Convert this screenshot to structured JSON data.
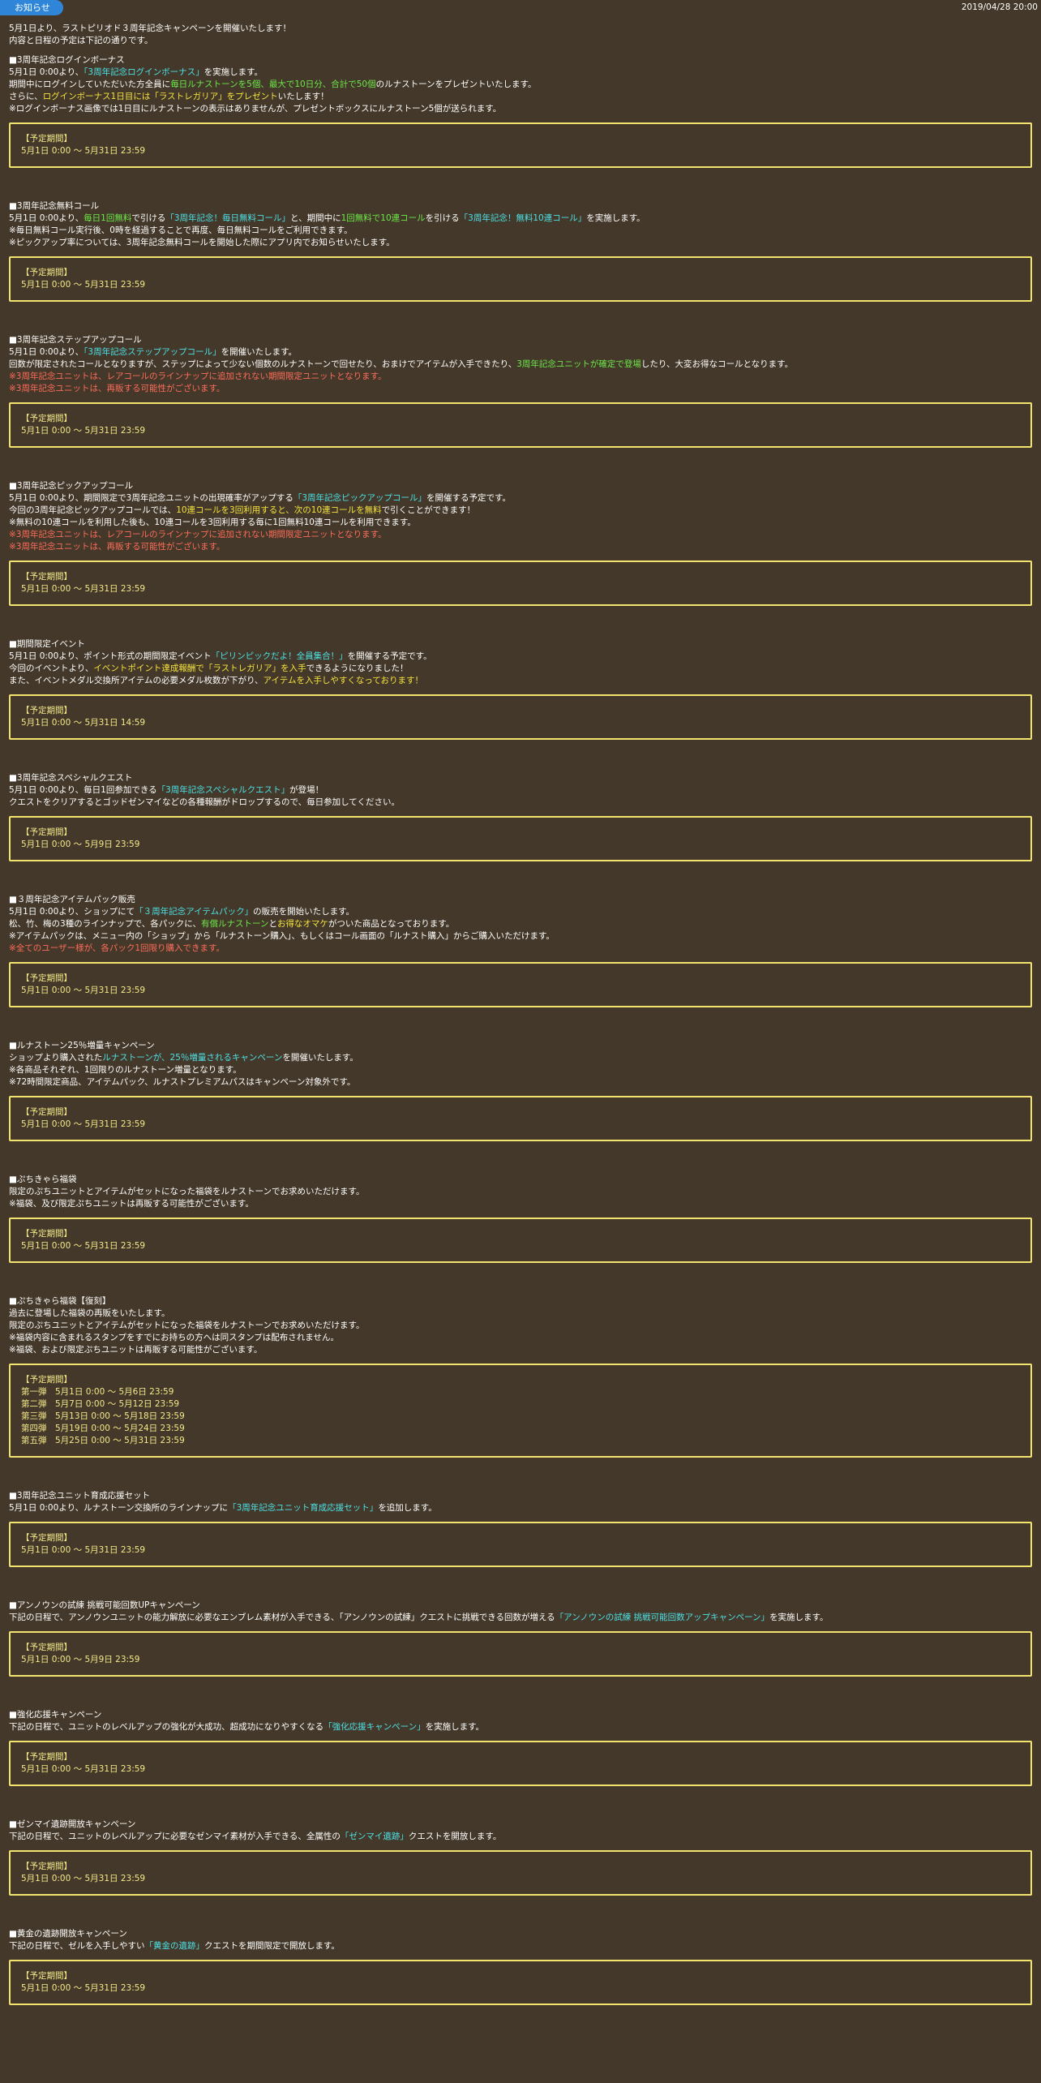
{
  "header": {
    "tab_label": "お知らせ",
    "date": "2019/04/28 20:00"
  },
  "intro": [
    "5月1日より、ラストピリオド３周年記念キャンペーンを開催いたします！",
    "内容と日程の予定は下記の通りです。"
  ],
  "period_label": "【予定期間】",
  "colors": {
    "background": "#433829",
    "box_border": "#f3e46f",
    "cyan": "#4de0e6",
    "green": "#6ee84a",
    "yellow": "#f6e33e",
    "red": "#ff6d5a",
    "tab_blue": "#2f86d8"
  },
  "sections": [
    {
      "title": "■3周年記念ログインボーナス",
      "lines": [
        [
          {
            "t": "5月1日 0:00より、"
          },
          {
            "t": "「3周年記念ログインボーナス」",
            "c": "c"
          },
          {
            "t": "を実施します。"
          }
        ],
        [
          {
            "t": "期間中にログインしていただいた方全員に"
          },
          {
            "t": "毎日ルナストーンを5個、最大で10日分、合計で50個",
            "c": "g"
          },
          {
            "t": "のルナストーンをプレゼントいたします。"
          }
        ],
        [
          {
            "t": "さらに、"
          },
          {
            "t": "ログインボーナス1日目には「ラストレガリア」をプレゼント",
            "c": "y"
          },
          {
            "t": "いたします！"
          }
        ],
        [
          {
            "t": "※ログインボーナス画像では1日目にルナストーンの表示はありませんが、プレゼントボックスにルナストーン5個が送られます。"
          }
        ]
      ],
      "periods": [
        "5月1日 0:00 ～ 5月31日 23:59"
      ]
    },
    {
      "title": "■3周年記念無料コール",
      "lines": [
        [
          {
            "t": "5月1日 0:00より、"
          },
          {
            "t": "毎日1回無料",
            "c": "g"
          },
          {
            "t": "で引ける"
          },
          {
            "t": "「3周年記念！毎日無料コール」",
            "c": "c"
          },
          {
            "t": "と、期間中に"
          },
          {
            "t": "1回無料で10連コール",
            "c": "g"
          },
          {
            "t": "を引ける"
          },
          {
            "t": "「3周年記念！無料10連コール」",
            "c": "c"
          },
          {
            "t": "を実施します。"
          }
        ],
        [
          {
            "t": "※毎日無料コール実行後、0時を経過することで再度、毎日無料コールをご利用できます。"
          }
        ],
        [
          {
            "t": "※ピックアップ率については、3周年記念無料コールを開始した際にアプリ内でお知らせいたします。"
          }
        ]
      ],
      "periods": [
        "5月1日 0:00 ～ 5月31日 23:59"
      ]
    },
    {
      "title": "■3周年記念ステップアップコール",
      "lines": [
        [
          {
            "t": "5月1日 0:00より、"
          },
          {
            "t": "「3周年記念ステップアップコール」",
            "c": "c"
          },
          {
            "t": "を開催いたします。"
          }
        ],
        [
          {
            "t": "回数が限定されたコールとなりますが、ステップによって少ない個数のルナストーンで回せたり、おまけでアイテムが入手できたり、"
          },
          {
            "t": "3周年記念ユニットが確定で登場",
            "c": "g"
          },
          {
            "t": "したり、大変お得なコールとなります。"
          }
        ],
        [
          {
            "t": "※3周年記念ユニットは、レアコールのラインナップに追加されない期間限定ユニットとなります。",
            "c": "r"
          }
        ],
        [
          {
            "t": "※3周年記念ユニットは、再販する可能性がございます。",
            "c": "r"
          }
        ]
      ],
      "periods": [
        "5月1日 0:00 ～ 5月31日 23:59"
      ]
    },
    {
      "title": "■3周年記念ピックアップコール",
      "lines": [
        [
          {
            "t": "5月1日 0:00より、期間限定で3周年記念ユニットの出現確率がアップする"
          },
          {
            "t": "「3周年記念ピックアップコール」",
            "c": "c"
          },
          {
            "t": "を開催する予定です。"
          }
        ],
        [
          {
            "t": "今回の3周年記念ピックアップコールでは、"
          },
          {
            "t": "10連コールを3回利用すると、次の10連コールを無料",
            "c": "y"
          },
          {
            "t": "で引くことができます！"
          }
        ],
        [
          {
            "t": "※無料の10連コールを利用した後も、10連コールを3回利用する毎に1回無料10連コールを利用できます。"
          }
        ],
        [
          {
            "t": "※3周年記念ユニットは、レアコールのラインナップに追加されない期間限定ユニットとなります。",
            "c": "r"
          }
        ],
        [
          {
            "t": "※3周年記念ユニットは、再販する可能性がございます。",
            "c": "r"
          }
        ]
      ],
      "periods": [
        "5月1日 0:00 ～ 5月31日 23:59"
      ]
    },
    {
      "title": "■期間限定イベント",
      "lines": [
        [
          {
            "t": "5月1日 0:00より、ポイント形式の期間限定イベント"
          },
          {
            "t": "「ピリンピックだよ！全員集合！」",
            "c": "c"
          },
          {
            "t": "を開催する予定です。"
          }
        ],
        [
          {
            "t": "今回のイベントより、"
          },
          {
            "t": "イベントポイント達成報酬で「ラストレガリア」を入手",
            "c": "y"
          },
          {
            "t": "できるようになりました！"
          }
        ],
        [
          {
            "t": "また、イベントメダル交換所アイテムの必要メダル枚数が下がり、"
          },
          {
            "t": "アイテムを入手しやすくなっております！",
            "c": "y"
          }
        ]
      ],
      "periods": [
        "5月1日 0:00 ～ 5月31日 14:59"
      ]
    },
    {
      "title": "■3周年記念スペシャルクエスト",
      "lines": [
        [
          {
            "t": "5月1日 0:00より、毎日1回参加できる"
          },
          {
            "t": "「3周年記念スペシャルクエスト」",
            "c": "c"
          },
          {
            "t": "が登場！"
          }
        ],
        [
          {
            "t": "クエストをクリアするとゴッドゼンマイなどの各種報酬がドロップするので、毎日参加してください。"
          }
        ]
      ],
      "periods": [
        "5月1日 0:00 ～ 5月9日 23:59"
      ]
    },
    {
      "title": "■３周年記念アイテムパック販売",
      "lines": [
        [
          {
            "t": "5月1日 0:00より、ショップにて"
          },
          {
            "t": "「３周年記念アイテムパック」",
            "c": "c"
          },
          {
            "t": "の販売を開始いたします。"
          }
        ],
        [
          {
            "t": "松、竹、梅の3種のラインナップで、各パックに、"
          },
          {
            "t": "有償ルナストーン",
            "c": "g"
          },
          {
            "t": "と"
          },
          {
            "t": "お得なオマケ",
            "c": "y"
          },
          {
            "t": "がついた商品となっております。"
          }
        ],
        [
          {
            "t": "※アイテムパックは、メニュー内の「ショップ」から「ルナストーン購入」、もしくはコール画面の「ルナスト購入」からご購入いただけます。"
          }
        ],
        [
          {
            "t": "※全てのユーザー様が、各パック1回限り購入できます。",
            "c": "r"
          }
        ]
      ],
      "periods": [
        "5月1日 0:00 ～ 5月31日 23:59"
      ]
    },
    {
      "title": "■ルナストーン25％増量キャンペーン",
      "lines": [
        [
          {
            "t": "ショップより購入された"
          },
          {
            "t": "ルナストーンが、25％増量されるキャンペーン",
            "c": "c"
          },
          {
            "t": "を開催いたします。"
          }
        ],
        [
          {
            "t": "※各商品それぞれ、1回限りのルナストーン増量となります。"
          }
        ],
        [
          {
            "t": "※72時間限定商品、アイテムパック、ルナストプレミアムパスはキャンペーン対象外です。"
          }
        ]
      ],
      "periods": [
        "5月1日 0:00 ～ 5月31日 23:59"
      ]
    },
    {
      "title": "■ぷちきゃら福袋",
      "lines": [
        [
          {
            "t": "限定のぷちユニットとアイテムがセットになった福袋をルナストーンでお求めいただけます。"
          }
        ],
        [
          {
            "t": "※福袋、及び限定ぷちユニットは再販する可能性がございます。"
          }
        ]
      ],
      "periods": [
        "5月1日 0:00 ～ 5月31日 23:59"
      ]
    },
    {
      "title": "■ぷちきゃら福袋【復刻】",
      "lines": [
        [
          {
            "t": "過去に登場した福袋の再販をいたします。"
          }
        ],
        [
          {
            "t": "限定のぷちユニットとアイテムがセットになった福袋をルナストーンでお求めいただけます。"
          }
        ],
        [
          {
            "t": "※福袋内容に含まれるスタンプをすでにお持ちの方へは同スタンプは配布されません。"
          }
        ],
        [
          {
            "t": "※福袋、および限定ぷちユニットは再販する可能性がございます。"
          }
        ]
      ],
      "periods": [
        "第一弾　5月1日 0:00 ～ 5月6日 23:59",
        "第二弾　5月7日 0:00 ～ 5月12日 23:59",
        "第三弾　5月13日 0:00 ～ 5月18日 23:59",
        "第四弾　5月19日 0:00 ～ 5月24日 23:59",
        "第五弾　5月25日 0:00 ～ 5月31日 23:59"
      ]
    },
    {
      "title": "■3周年記念ユニット育成応援セット",
      "lines": [
        [
          {
            "t": "5月1日 0:00より、ルナストーン交換所のラインナップに"
          },
          {
            "t": "「3周年記念ユニット育成応援セット」",
            "c": "c"
          },
          {
            "t": "を追加します。"
          }
        ]
      ],
      "periods": [
        "5月1日 0:00 ～ 5月31日 23:59"
      ]
    },
    {
      "title": "■アンノウンの試練 挑戦可能回数UPキャンペーン",
      "lines": [
        [
          {
            "t": "下記の日程で、アンノウンユニットの能力解放に必要なエンブレム素材が入手できる、「アンノウンの試練」クエストに挑戦できる回数が増える"
          },
          {
            "t": "「アンノウンの試練 挑戦可能回数アップキャンペーン」",
            "c": "c"
          },
          {
            "t": "を実施します。"
          }
        ]
      ],
      "periods": [
        "5月1日 0:00 ～ 5月9日 23:59"
      ]
    },
    {
      "title": "■強化応援キャンペーン",
      "lines": [
        [
          {
            "t": "下記の日程で、ユニットのレベルアップの強化が大成功、超成功になりやすくなる"
          },
          {
            "t": "「強化応援キャンペーン」",
            "c": "c"
          },
          {
            "t": "を実施します。"
          }
        ]
      ],
      "periods": [
        "5月1日 0:00 ～ 5月31日 23:59"
      ]
    },
    {
      "title": "■ゼンマイ遺跡開放キャンペーン",
      "lines": [
        [
          {
            "t": "下記の日程で、ユニットのレベルアップに必要なゼンマイ素材が入手できる、全属性の"
          },
          {
            "t": "「ゼンマイ遺跡」",
            "c": "c"
          },
          {
            "t": "クエストを開放します。"
          }
        ]
      ],
      "periods": [
        "5月1日 0:00 ～ 5月31日 23:59"
      ]
    },
    {
      "title": "■黄金の遺跡開放キャンペーン",
      "lines": [
        [
          {
            "t": "下記の日程で、ゼルを入手しやすい"
          },
          {
            "t": "「黄金の遺跡」",
            "c": "c"
          },
          {
            "t": "クエストを期間限定で開放します。"
          }
        ]
      ],
      "periods": [
        "5月1日 0:00 ～ 5月31日 23:59"
      ]
    }
  ]
}
